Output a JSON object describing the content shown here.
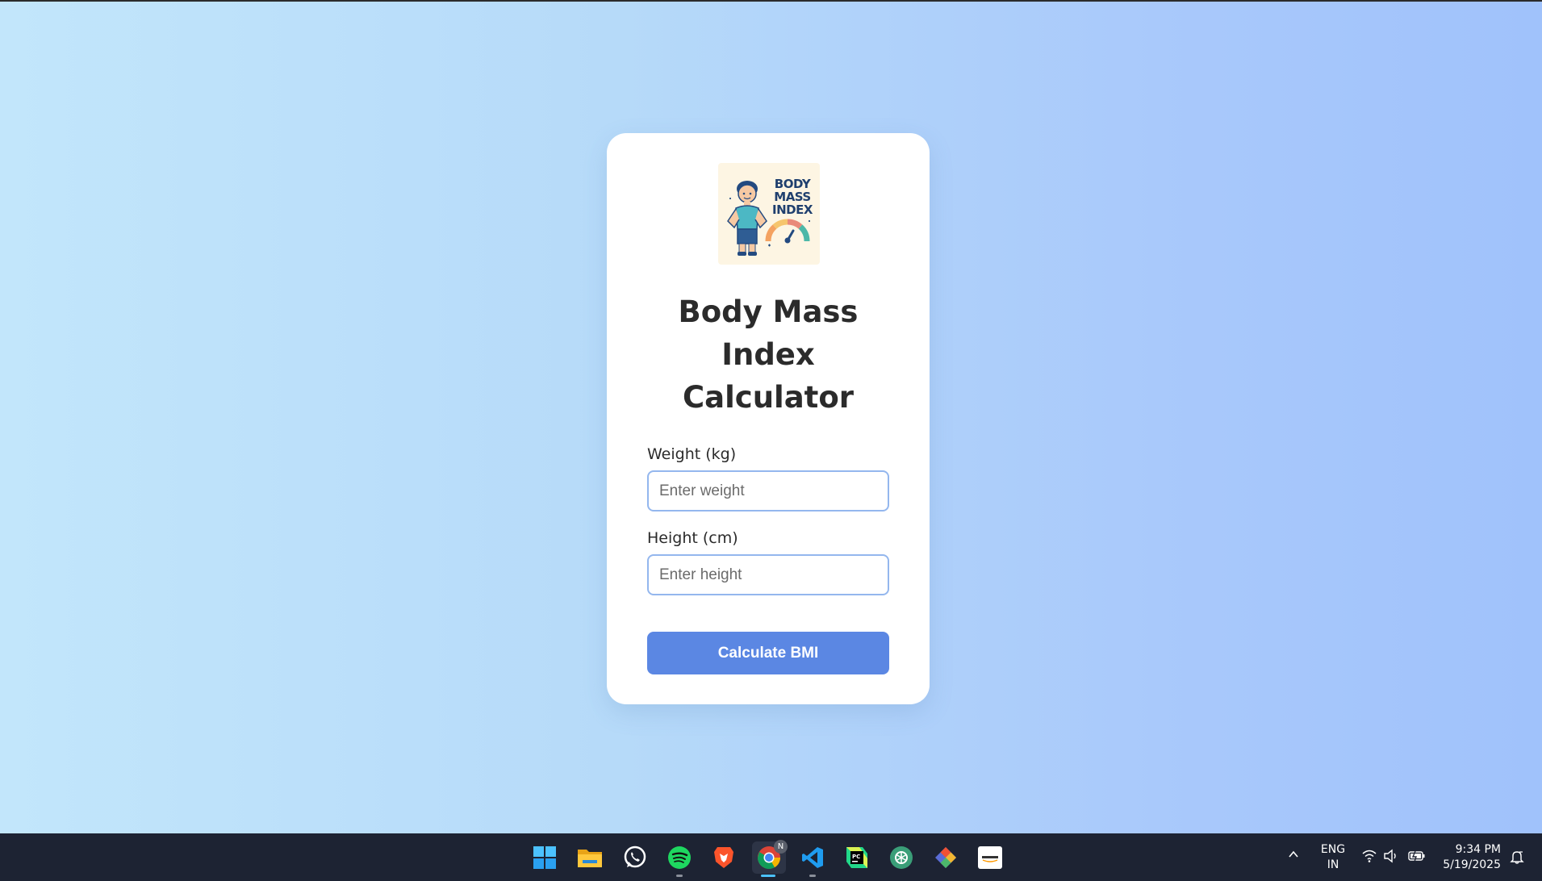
{
  "page": {
    "background": "#b6daf9",
    "accent": "#5b87e3"
  },
  "card": {
    "logo": {
      "line1": "BODY",
      "line2": "MASS",
      "line3": "INDEX"
    },
    "title_line1": "Body Mass",
    "title_line2": "Index",
    "title_line3": "Calculator",
    "weight_label": "Weight (kg)",
    "weight_placeholder": "Enter weight",
    "weight_value": "",
    "height_label": "Height (cm)",
    "height_placeholder": "Enter height",
    "height_value": "",
    "button_label": "Calculate BMI"
  },
  "taskbar": {
    "apps": [
      {
        "name": "start-icon"
      },
      {
        "name": "file-explorer-icon"
      },
      {
        "name": "whatsapp-icon"
      },
      {
        "name": "spotify-icon"
      },
      {
        "name": "brave-icon"
      },
      {
        "name": "chrome-icon",
        "badge": "N"
      },
      {
        "name": "vscode-icon"
      },
      {
        "name": "pycharm-icon"
      },
      {
        "name": "chatgpt-icon"
      },
      {
        "name": "git-icon"
      },
      {
        "name": "amazon-icon"
      }
    ],
    "language_line1": "ENG",
    "language_line2": "IN",
    "time": "9:34 PM",
    "date": "5/19/2025"
  }
}
